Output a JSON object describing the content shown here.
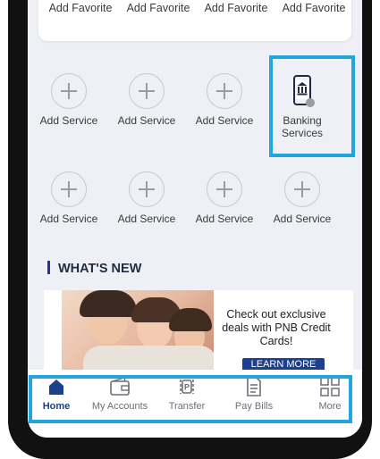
{
  "favorites": [
    "Add Favorite",
    "Add Favorite",
    "Add Favorite",
    "Add Favorite"
  ],
  "services_row1": [
    "Add Service",
    "Add Service",
    "Add Service",
    "Banking Services"
  ],
  "services_row2": [
    "Add Service",
    "Add Service",
    "Add Service",
    "Add Service"
  ],
  "whats_new": {
    "title": "WHAT'S NEW"
  },
  "promo": {
    "text": "Check out exclusive deals with PNB Credit Cards!",
    "button": "LEARN MORE"
  },
  "tabs": [
    {
      "label": "Home",
      "icon": "home-icon",
      "active": true
    },
    {
      "label": "My Accounts",
      "icon": "wallet-icon",
      "active": false
    },
    {
      "label": "Transfer",
      "icon": "transfer-icon",
      "active": false
    },
    {
      "label": "Pay Bills",
      "icon": "bill-icon",
      "active": false
    },
    {
      "label": "More",
      "icon": "grid-icon",
      "active": false
    }
  ],
  "colors": {
    "highlight": "#21a5de",
    "brand": "#1c3f8f"
  }
}
